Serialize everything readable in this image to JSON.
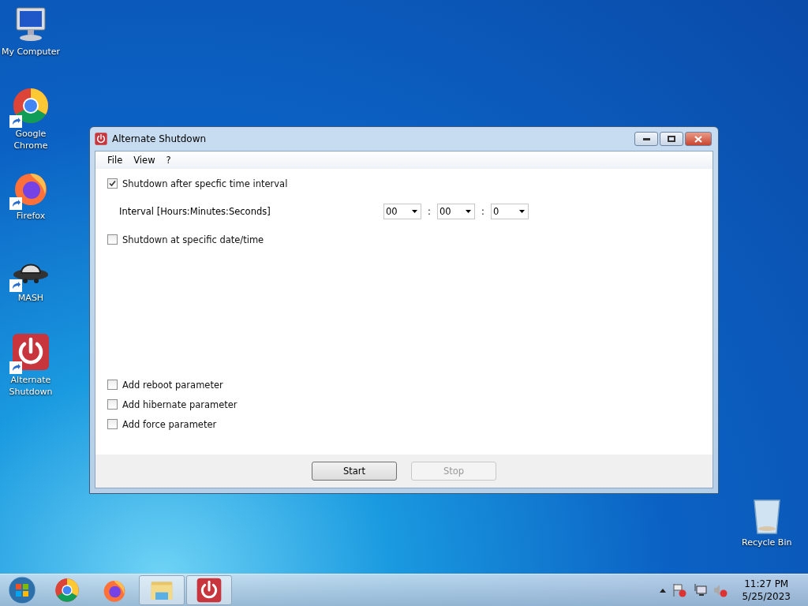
{
  "desktop_icons": [
    {
      "label": "My Computer",
      "kind": "computer",
      "shortcut": false
    },
    {
      "label": "Google Chrome",
      "kind": "chrome",
      "shortcut": true
    },
    {
      "label": "Firefox",
      "kind": "firefox",
      "shortcut": true
    },
    {
      "label": "MASH",
      "kind": "hat",
      "shortcut": true
    },
    {
      "label": "Alternate Shutdown",
      "kind": "power",
      "shortcut": true
    }
  ],
  "recycle_bin": {
    "label": "Recycle Bin"
  },
  "window": {
    "title": "Alternate Shutdown",
    "menu": [
      "File",
      "View",
      "?"
    ],
    "interval_option": {
      "label": "Shutdown after specfic time interval",
      "checked": true
    },
    "interval": {
      "label": "Interval [Hours:Minutes:Seconds]",
      "fields": [
        {
          "value": "00"
        },
        {
          "value": "00"
        },
        {
          "value": "0"
        }
      ],
      "separators": [
        ":",
        ":"
      ]
    },
    "datetime_option": {
      "label": "Shutdown at specific date/time",
      "checked": false
    },
    "parameters": [
      {
        "label": "Add reboot parameter",
        "checked": false
      },
      {
        "label": "Add hibernate parameter",
        "checked": false
      },
      {
        "label": "Add force parameter",
        "checked": false
      }
    ],
    "buttons": [
      {
        "label": "Start",
        "disabled": false
      },
      {
        "label": "Stop",
        "disabled": true
      }
    ]
  },
  "taskbar": {
    "items": [
      {
        "kind": "chrome",
        "running": false
      },
      {
        "kind": "firefox",
        "running": false
      },
      {
        "kind": "folder",
        "running": true
      },
      {
        "kind": "power",
        "running": true
      }
    ],
    "time": "11:27 PM",
    "date": "5/25/2023"
  }
}
